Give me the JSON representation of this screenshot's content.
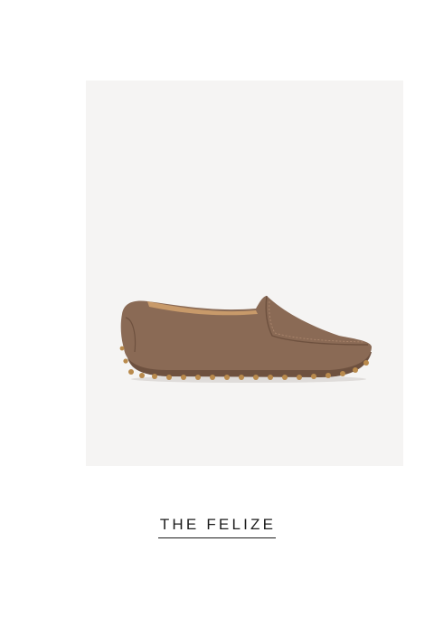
{
  "product": {
    "name": "THE FELIZE",
    "image_subject": "loafer-shoe",
    "colors": {
      "image_background": "#f5f4f3",
      "leather": "#8a6a55",
      "leather_dark": "#6e513f",
      "sole_nubs": "#b98a4c",
      "lining": "#c89a6a",
      "title_text": "#1c1c1c"
    }
  }
}
